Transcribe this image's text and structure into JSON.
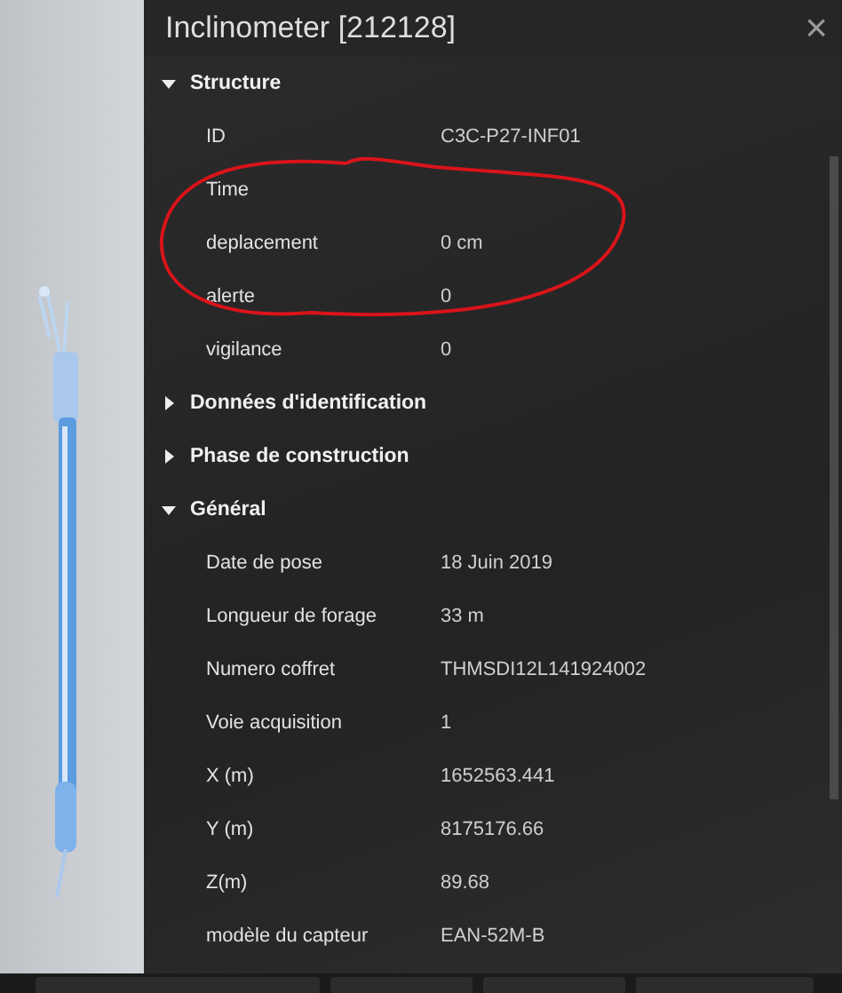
{
  "window": {
    "title": "Inclinometer [212128]",
    "close": "×"
  },
  "sections": [
    {
      "title": "Structure",
      "expanded": true,
      "rows": [
        {
          "label": "ID",
          "value": "C3C-P27-INF01"
        },
        {
          "label": "Time"
        },
        {
          "label": "deplacement",
          "value": "0 cm"
        },
        {
          "label": "alerte",
          "value": "0"
        },
        {
          "label": "vigilance",
          "value": "0"
        }
      ]
    },
    {
      "title": "Données d'identification",
      "expanded": false
    },
    {
      "title": "Phase de construction",
      "expanded": false
    },
    {
      "title": "Général",
      "expanded": true,
      "rows": [
        {
          "label": "Date de pose",
          "value": "18 Juin 2019"
        },
        {
          "label": "Longueur de forage",
          "value": "33 m"
        },
        {
          "label": "Numero coffret",
          "value": "THMSDI12L141924002"
        },
        {
          "label": "Voie acquisition",
          "value": "1"
        },
        {
          "label": "X (m)",
          "value": "1652563.441"
        },
        {
          "label": "Y (m)",
          "value": "8175176.66"
        },
        {
          "label": "Z(m)",
          "value": "89.68"
        },
        {
          "label": "modèle du capteur",
          "value": "EAN-52M-B"
        }
      ]
    }
  ]
}
